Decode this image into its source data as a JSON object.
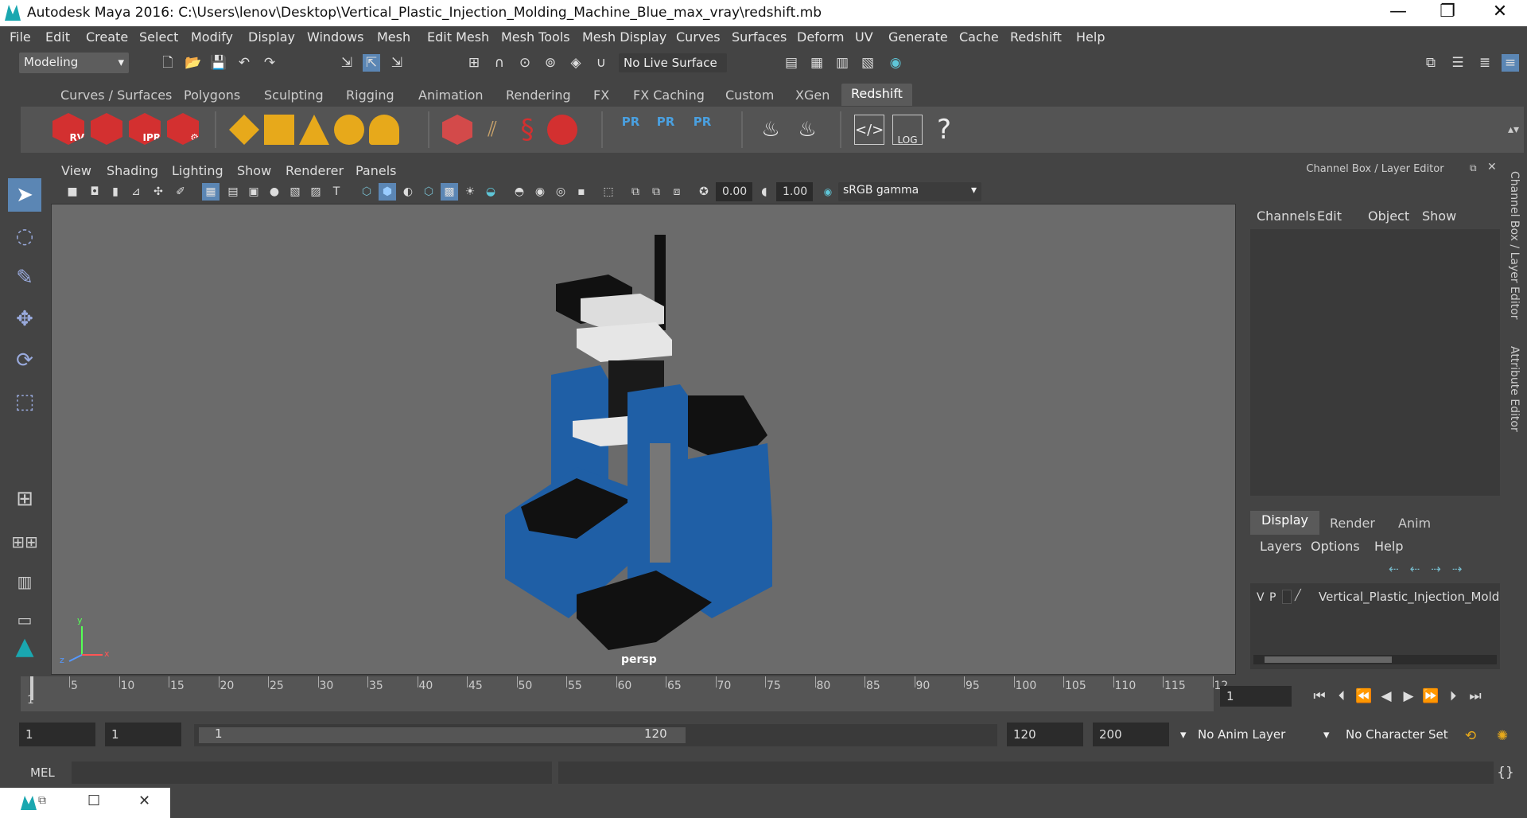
{
  "window": {
    "title": "Autodesk Maya 2016: C:\\Users\\lenov\\Desktop\\Vertical_Plastic_Injection_Molding_Machine_Blue_max_vray\\redshift.mb",
    "minimize": "—",
    "maximize": "❐",
    "close": "✕"
  },
  "menubar": [
    "File",
    "Edit",
    "Create",
    "Select",
    "Modify",
    "Display",
    "Windows",
    "Mesh",
    "Edit Mesh",
    "Mesh Tools",
    "Mesh Display",
    "Curves",
    "Surfaces",
    "Deform",
    "UV",
    "Generate",
    "Cache",
    "Redshift",
    "Help"
  ],
  "status": {
    "mode": "Modeling",
    "live_surface": "No Live Surface"
  },
  "shelf_tabs": [
    "Curves / Surfaces",
    "Polygons",
    "Sculpting",
    "Rigging",
    "Animation",
    "Rendering",
    "FX",
    "FX Caching",
    "Custom",
    "XGen",
    "Redshift"
  ],
  "shelf_active": "Redshift",
  "shelf_icons": {
    "rv": "RV",
    "ipr": "IPR",
    "pr": "PR",
    "log": "LOG",
    "help": "?"
  },
  "viewport": {
    "menu": [
      "View",
      "Shading",
      "Lighting",
      "Show",
      "Renderer",
      "Panels"
    ],
    "exposure": "0.00",
    "gamma": "1.00",
    "color_space": "sRGB gamma",
    "camera": "persp",
    "axis_y": "y",
    "axis_z": "z",
    "axis_x": "x"
  },
  "channel_box": {
    "title": "Channel Box / Layer Editor",
    "menu": [
      "Channels",
      "Edit",
      "Object",
      "Show"
    ],
    "layer_tabs": [
      "Display",
      "Render",
      "Anim"
    ],
    "layer_menu": [
      "Layers",
      "Options",
      "Help"
    ],
    "layer": {
      "v": "V",
      "p": "P",
      "name": "Vertical_Plastic_Injection_Mold"
    }
  },
  "side_tabs": {
    "channel": "Channel Box / Layer Editor",
    "attribute": "Attribute Editor"
  },
  "timeline": {
    "ticks": [
      "5",
      "10",
      "15",
      "20",
      "25",
      "30",
      "35",
      "40",
      "45",
      "50",
      "55",
      "60",
      "65",
      "70",
      "75",
      "80",
      "85",
      "90",
      "95",
      "100",
      "105",
      "110",
      "115",
      "12"
    ],
    "start": "1",
    "current_frame": "1"
  },
  "range": {
    "start": "1",
    "playback_start": "1",
    "slider_start": "1",
    "slider_end": "120",
    "playback_end": "120",
    "end": "200",
    "anim_layer": "No Anim Layer",
    "character_set": "No Character Set"
  },
  "command": {
    "label": "MEL"
  },
  "colors": {
    "accent_blue": "#1f5fa6",
    "cube_red": "#d33030",
    "gold": "#e7a91b"
  }
}
